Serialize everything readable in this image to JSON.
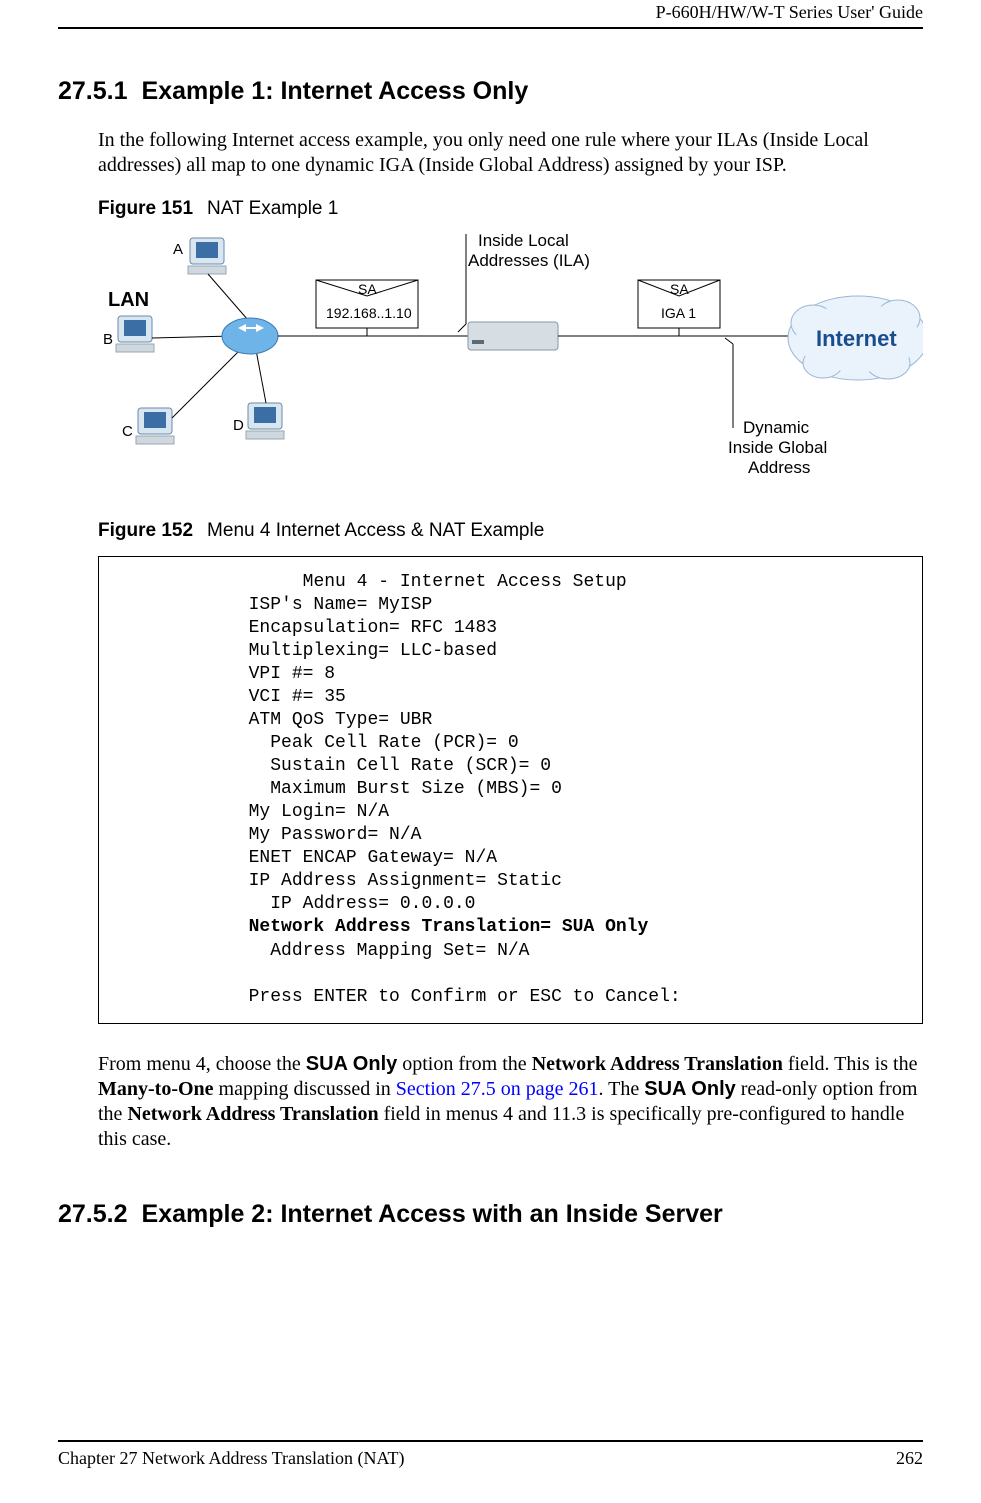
{
  "header": {
    "running_head": "P-660H/HW/W-T Series User' Guide"
  },
  "sections": {
    "s1": {
      "num": "27.5.1",
      "title": "Example 1: Internet Access Only",
      "intro": "In the following Internet access example, you only need one rule where your ILAs (Inside Local addresses) all map to one dynamic IGA (Inside Global Address) assigned by your ISP."
    },
    "s2": {
      "num": "27.5.2",
      "title": "Example 2: Internet Access with an Inside Server"
    }
  },
  "figures": {
    "f151": {
      "label": "Figure 151",
      "caption": "NAT Example 1"
    },
    "f152": {
      "label": "Figure 152",
      "caption": "Menu 4 Internet Access & NAT Example"
    }
  },
  "diagram": {
    "lan": "LAN",
    "a": "A",
    "b": "B",
    "c": "C",
    "d": "D",
    "sa1": "SA",
    "sa1_ip": "192.168..1.10",
    "ila_line1": "Inside Local",
    "ila_line2": "Addresses (ILA)",
    "sa2": "SA",
    "sa2_sub": "IGA 1",
    "internet": "Internet",
    "dyn1": "Dynamic",
    "dyn2": "Inside Global",
    "dyn3": "Address"
  },
  "terminal": {
    "title": "Menu 4 - Internet Access Setup",
    "isp": "ISP's Name= MyISP",
    "encap": "Encapsulation= RFC 1483",
    "mux": "Multiplexing= LLC-based",
    "vpi": "VPI #= 8",
    "vci": "VCI #= 35",
    "qos": "ATM QoS Type= UBR",
    "pcr": "Peak Cell Rate (PCR)= 0",
    "scr": "Sustain Cell Rate (SCR)= 0",
    "mbs": "Maximum Burst Size (MBS)= 0",
    "login": "My Login= N/A",
    "pass": "My Password= N/A",
    "enet": "ENET ENCAP Gateway= N/A",
    "ipassign": "IP Address Assignment= Static",
    "ipaddr": "IP Address= 0.0.0.0",
    "nat": "Network Address Translation= SUA Only",
    "mapset": "Address Mapping Set= N/A",
    "press": "Press ENTER to Confirm or ESC to Cancel:"
  },
  "para2": {
    "t1": "From menu 4, choose the ",
    "sua": "SUA Only",
    "t2": " option from the ",
    "natfield": "Network Address Translation",
    "t3": " field. This is the ",
    "m2o": "Many-to-One",
    "t4": " mapping discussed in ",
    "link": "Section 27.5 on page 261",
    "t5": ". The ",
    "sua2": "SUA Only",
    "t6": " read-only option from the ",
    "natfield2": "Network Address Translation",
    "t7": " field in menus 4 and 11.3 is specifically pre-configured to handle this case."
  },
  "footer": {
    "chapter": "Chapter 27 Network Address Translation (NAT)",
    "page": "262"
  }
}
